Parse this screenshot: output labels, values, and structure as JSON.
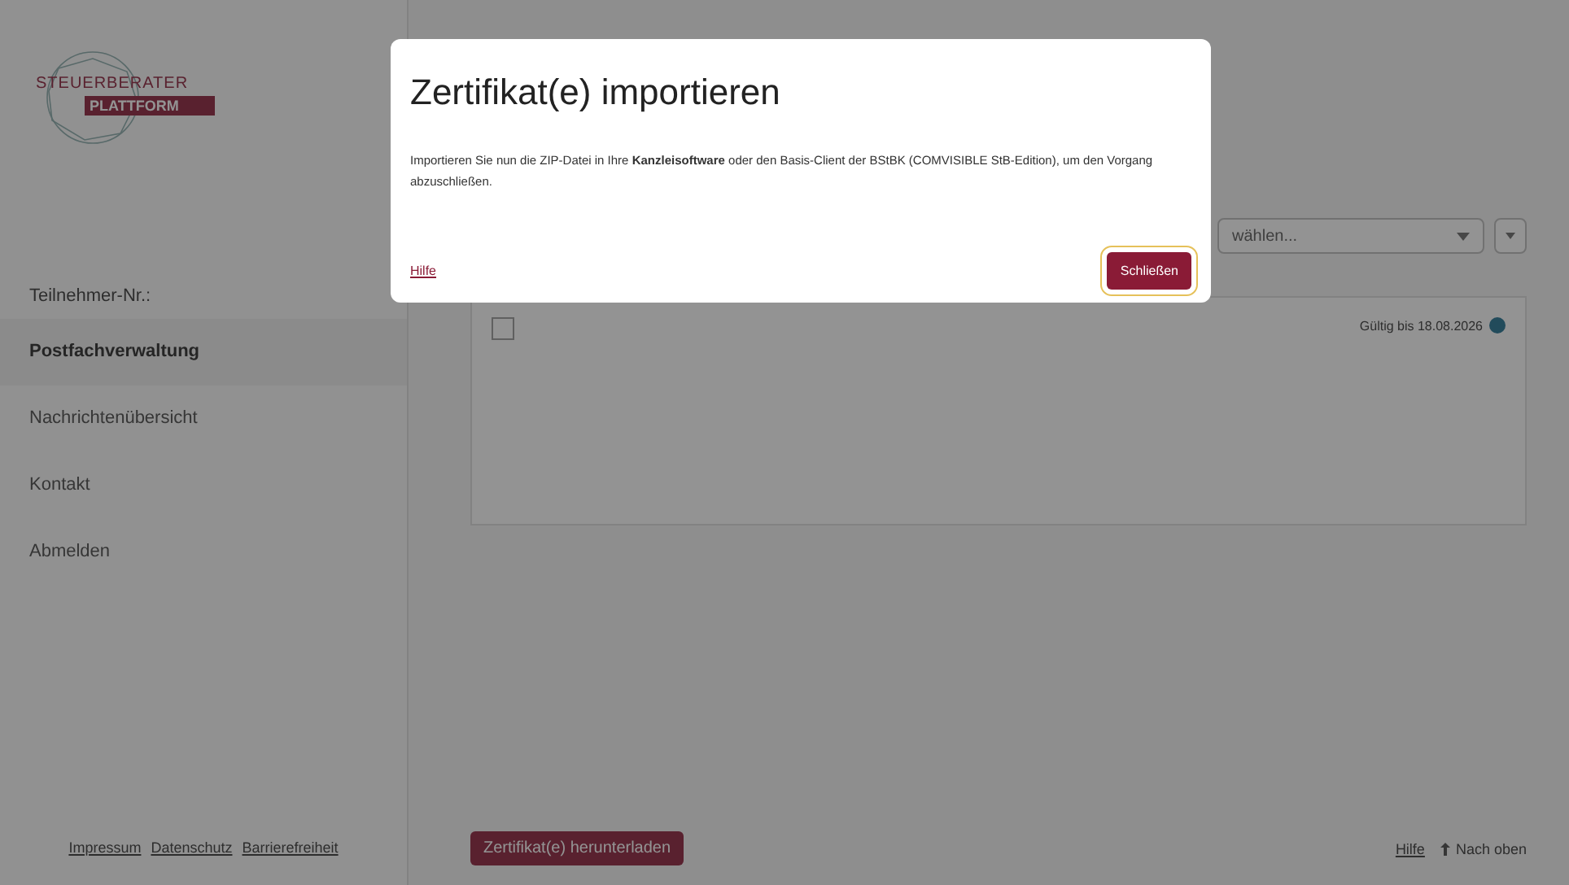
{
  "logo": {
    "line_1": "STEUERBERATER",
    "line_2": "PLATTFORM"
  },
  "sidebar": {
    "user_line": "Teilnehmer-Nr.:",
    "items": [
      {
        "label": "Postfachverwaltung",
        "selected": true
      },
      {
        "label": "Nachrichtenübersicht",
        "selected": false
      },
      {
        "label": "Kontakt",
        "selected": false
      },
      {
        "label": "Abmelden",
        "selected": false
      }
    ],
    "footer_links": [
      "Impressum",
      "Datenschutz",
      "Barrierefreiheit"
    ]
  },
  "main": {
    "select": {
      "placeholder": "wählen..."
    },
    "card": {
      "checked": false,
      "valid_until": "Gültig bis 18.08.2026"
    },
    "download_button": "Zertifikat(e) herunterladen",
    "help_link": "Hilfe",
    "top_link": "Nach oben"
  },
  "dialog": {
    "title": "Zertifikat(e) importieren",
    "text": "Importieren Sie nun die ZIP-Datei in Ihre **Kanzleisoftware** oder den Basis-Client der BStBK (COMVISIBLE StB-Edition), um den Vorgang abzuschließen.",
    "help_link": "Hilfe",
    "close_button": "Schließen"
  }
}
